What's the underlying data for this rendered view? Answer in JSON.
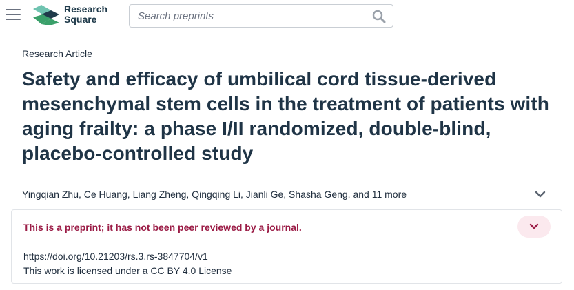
{
  "header": {
    "logo_line1": "Research",
    "logo_line2": "Square",
    "search_placeholder": "Search preprints",
    "colors": {
      "logo_green": "#3aa06a",
      "logo_dark": "#1f3a4a",
      "logo_teal": "#6fc3b0"
    }
  },
  "article": {
    "type": "Research Article",
    "title": "Safety and efficacy of umbilical cord tissue-derived mesenchymal stem cells in the treatment of patients with aging frailty: a phase I/II randomized, double-blind, placebo-controlled study",
    "authors": "Yingqian Zhu, Ce Huang, Liang Zheng, Qingqing Li, Jianli Ge, Shasha Geng, and 11 more"
  },
  "notice": {
    "text": "This is a preprint; it has not been peer reviewed by a journal.",
    "doi": "https://doi.org/10.21203/rs.3.rs-3847704/v1",
    "license": "This work is licensed under a CC BY 4.0 License",
    "colors": {
      "warning_text": "#9b1c46",
      "toggle_bg": "#fbe9ee"
    }
  },
  "icons": {
    "menu": "hamburger-menu-icon",
    "search": "search-icon",
    "authors_expand": "chevron-down-icon",
    "notice_expand": "chevron-down-icon"
  }
}
